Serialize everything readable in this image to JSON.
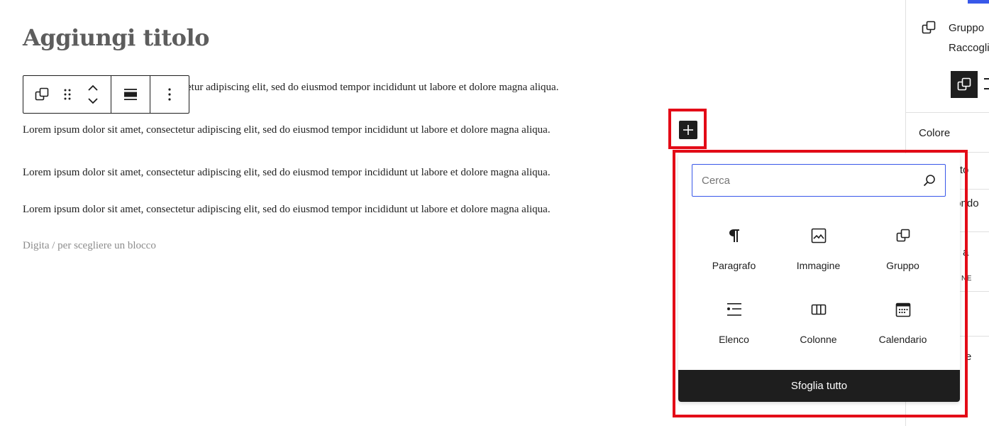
{
  "editor": {
    "title": "Aggiungi titolo",
    "paragraphs": [
      "etur adipiscing elit, sed do eiusmod tempor incididunt ut labore et dolore magna aliqua.",
      "Lorem ipsum dolor sit amet, consectetur adipiscing elit, sed do eiusmod tempor incididunt ut labore et dolore magna aliqua.",
      "Lorem ipsum dolor sit amet, consectetur adipiscing elit, sed do eiusmod tempor incididunt ut labore et dolore magna aliqua.",
      "Lorem ipsum dolor sit amet, consectetur adipiscing elit, sed do eiusmod tempor incididunt ut labore et dolore magna aliqua."
    ],
    "placeholder": "Digita / per scegliere un blocco"
  },
  "toolbar": {
    "icons": [
      "group-icon",
      "drag-handle-icon",
      "move-up-down-icon",
      "align-icon",
      "more-options-icon"
    ]
  },
  "sidebar": {
    "block_name": "Gruppo",
    "block_desc": "Raccogli",
    "section_colore": "Colore",
    "item_testo": "esto",
    "item_sfondo": "fondo",
    "item_clipped_a": "a",
    "item_clipped_ne": "NE",
    "item_clipped_e": "e"
  },
  "inserter": {
    "search_placeholder": "Cerca",
    "search_value": "",
    "blocks": [
      {
        "label": "Paragrafo",
        "icon": "paragraph-icon"
      },
      {
        "label": "Immagine",
        "icon": "image-icon"
      },
      {
        "label": "Gruppo",
        "icon": "group-icon"
      },
      {
        "label": "Elenco",
        "icon": "list-icon"
      },
      {
        "label": "Colonne",
        "icon": "columns-icon"
      },
      {
        "label": "Calendario",
        "icon": "calendar-icon"
      }
    ],
    "browse_all": "Sfoglia tutto"
  },
  "colors": {
    "highlight": "#e30b17",
    "accent": "#3858e9",
    "dark": "#1e1e1e"
  }
}
